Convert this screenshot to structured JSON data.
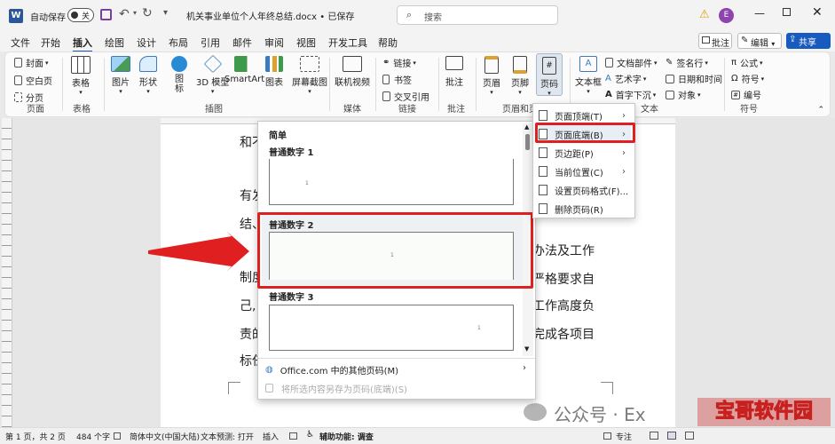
{
  "titlebar": {
    "autosave_label": "自动保存",
    "autosave_state": "关",
    "doc_title": "机关事业单位个人年终总结.docx • 已保存",
    "search_placeholder": "搜索",
    "user_initial": "E"
  },
  "menu": {
    "tabs": [
      "文件",
      "开始",
      "插入",
      "绘图",
      "设计",
      "布局",
      "引用",
      "邮件",
      "审阅",
      "视图",
      "开发工具",
      "帮助"
    ],
    "active_tab": "插入",
    "comment_btn": "批注",
    "edit_btn": "编辑",
    "share_btn": "共享"
  },
  "ribbon": {
    "pages": {
      "cover": "封面",
      "blank": "空白页",
      "break": "分页",
      "group": "页面"
    },
    "table": {
      "label": "表格",
      "group": "表格"
    },
    "illus": {
      "picture": "图片",
      "shape": "形状",
      "icon": "图标",
      "model3d": "3D 模型",
      "smartart": "SmartArt",
      "chart": "图表",
      "screenshot": "屏幕截图",
      "group": "插图"
    },
    "media": {
      "video": "联机视频",
      "group": "媒体"
    },
    "links": {
      "link": "链接",
      "bookmark": "书签",
      "crossref": "交叉引用",
      "group": "链接"
    },
    "comments": {
      "comment": "批注",
      "group": "批注"
    },
    "hf": {
      "header": "页眉",
      "footer": "页脚",
      "pagenum": "页码",
      "group": "页眉和页脚"
    },
    "text": {
      "textbox": "文本框",
      "docparts": "文档部件",
      "wordart": "艺术字",
      "dropcap": "首字下沉",
      "signature": "签名行",
      "datetime": "日期和时间",
      "object": "对象",
      "group": "文本"
    },
    "symbols": {
      "equation": "公式",
      "symbol": "符号",
      "number": "编号",
      "group": "符号"
    }
  },
  "document": {
    "lines": [
      "和不",
      "有发",
      "结、",
      "制度",
      "己,",
      "责的",
      "标任"
    ],
    "right_lines": [
      "办法及工作",
      "严格要求自",
      "工作高度负",
      "完成各项目"
    ]
  },
  "gallery": {
    "section": "简单",
    "items": [
      "普通数字 1",
      "普通数字 2",
      "普通数字 3"
    ],
    "more": "Office.com 中的其他页码(M)",
    "save_sel": "将所选内容另存为页码(底端)(S)",
    "page_mark": "1"
  },
  "submenu": {
    "items": [
      "页面顶端(T)",
      "页面底端(B)",
      "页边距(P)",
      "当前位置(C)",
      "设置页码格式(F)...",
      "删除页码(R)"
    ]
  },
  "status": {
    "page": "第 1 页，共 2 页",
    "words": "484 个字",
    "lang": "简体中文(中国大陆)",
    "predict": "文本预测: 打开",
    "insert": "插入",
    "access": "辅助功能: 调查",
    "focus": "专注"
  },
  "watermark": {
    "account": "公众号 · Ex",
    "site": "宝哥软件园"
  },
  "colors": {
    "accent": "#2b579a",
    "highlight": "#e02020",
    "active_tab": "#185abd"
  }
}
